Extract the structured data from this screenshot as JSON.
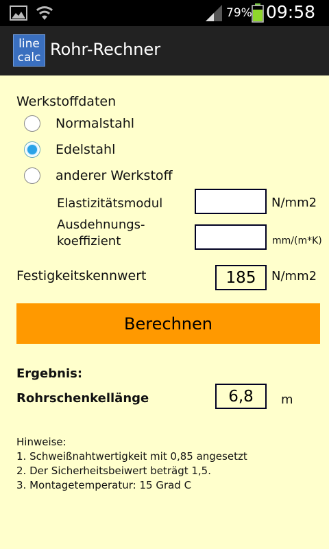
{
  "status_bar": {
    "battery_percent": "79%",
    "time": "09:58",
    "icons": [
      "image-icon",
      "wifi-icon",
      "signal-icon",
      "battery-icon"
    ]
  },
  "app": {
    "logo_line1": "line",
    "logo_line2": "calc",
    "title": "Rohr-Rechner"
  },
  "material": {
    "section_label": "Werkstoffdaten",
    "options": [
      {
        "label": "Normalstahl",
        "checked": false
      },
      {
        "label": "Edelstahl",
        "checked": true
      },
      {
        "label": "anderer Werkstoff",
        "checked": false
      }
    ],
    "elastic_label": "Elastizitätsmodul",
    "elastic_value": "",
    "elastic_unit": "N/mm2",
    "expansion_label_1": "Ausdehnungs-",
    "expansion_label_2": "koeffizient",
    "expansion_value": "",
    "expansion_unit": "mm/(m*K)"
  },
  "strength": {
    "label": "Festigkeitskennwert",
    "value": "185",
    "unit": "N/mm2"
  },
  "calculate_label": "Berechnen",
  "result": {
    "heading": "Ergebnis:",
    "label": "Rohrschenkellänge",
    "value": "6,8",
    "unit": "m"
  },
  "notes": {
    "heading": "Hinweise:",
    "lines": [
      "1. Schweißnahtwertigkeit mit 0,85 angesetzt",
      "2. Der Sicherheitsbeiwert beträgt 1,5.",
      "3. Montagetemperatur: 15 Grad C"
    ]
  },
  "colors": {
    "background": "#ffffcc",
    "button": "#ff9900",
    "radio_selected": "#2aa3e8",
    "logo": "#3a6fbf"
  }
}
